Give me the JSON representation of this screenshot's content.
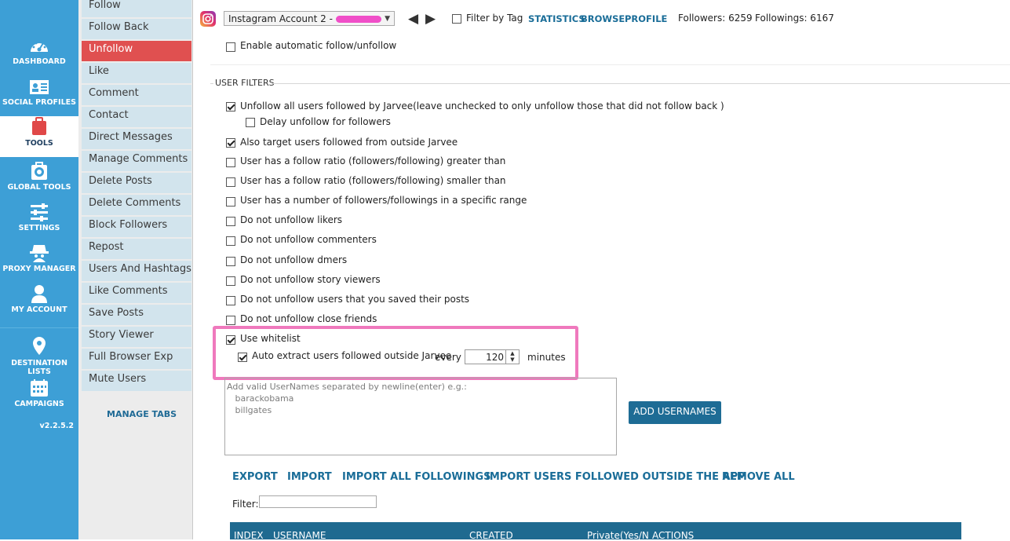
{
  "nav": {
    "items": [
      {
        "label": "DASHBOARD"
      },
      {
        "label": "SOCIAL PROFILES"
      },
      {
        "label": "TOOLS"
      },
      {
        "label": "GLOBAL TOOLS"
      },
      {
        "label": "SETTINGS"
      },
      {
        "label": "PROXY MANAGER"
      },
      {
        "label": "MY ACCOUNT"
      },
      {
        "label": "DESTINATION LISTS"
      },
      {
        "label": "CAMPAIGNS"
      }
    ],
    "active": "TOOLS",
    "version": "v2.2.5.2",
    "accent_color": "#3d9fd6"
  },
  "submenu": {
    "items": [
      "Follow",
      "Follow Back",
      "Unfollow",
      "Like",
      "Comment",
      "Contact",
      "Direct Messages",
      "Manage Comments",
      "Delete Posts",
      "Delete Comments",
      "Block Followers",
      "Repost",
      "Users And Hashtags",
      "Like Comments",
      "Save Posts",
      "Story Viewer",
      "Full Browser Exp",
      "Mute Users"
    ],
    "active": "Unfollow",
    "manage_tabs": "MANAGE TABS",
    "active_color": "#e05050"
  },
  "topbar": {
    "account": "Instagram Account 2 -",
    "filter_by_tag": "Filter by Tag",
    "links": [
      "STATISTICS",
      "BROWSE",
      "PROFILE"
    ],
    "followers": "Followers: 6259",
    "followings": "Followings: 6167"
  },
  "settings": {
    "enable_auto": {
      "label": "Enable automatic follow/unfollow",
      "checked": false
    },
    "section_title": "USER FILTERS",
    "filters": [
      {
        "label": "Unfollow all users followed by Jarvee(leave unchecked to only unfollow those that did not follow back )",
        "checked": true
      },
      {
        "label": "Delay unfollow for followers",
        "checked": false
      },
      {
        "label": "Also target users followed from outside Jarvee",
        "checked": true
      },
      {
        "label": "User has a follow ratio (followers/following) greater than",
        "checked": false
      },
      {
        "label": "User has a follow ratio (followers/following) smaller than",
        "checked": false
      },
      {
        "label": "User has a number of followers/followings in a specific range",
        "checked": false
      },
      {
        "label": "Do not unfollow likers",
        "checked": false
      },
      {
        "label": "Do not unfollow commenters",
        "checked": false
      },
      {
        "label": "Do not unfollow dmers",
        "checked": false
      },
      {
        "label": "Do not unfollow story viewers",
        "checked": false
      },
      {
        "label": "Do not unfollow users that you saved their posts",
        "checked": false
      },
      {
        "label": "Do not unfollow close friends",
        "checked": false
      }
    ],
    "whitelist": {
      "label": "Use whitelist",
      "checked": true
    },
    "auto_extract": {
      "label": "Auto extract users followed outside Jarvee",
      "checked": true,
      "every": "every",
      "value": "120",
      "unit": "minutes"
    },
    "highlight_color": "#ef79bd"
  },
  "whitelist_box": {
    "placeholder": "Add valid UserNames separated by newline(enter) e.g.:\n   barackobama\n   billgates",
    "add_button": "ADD USERNAMES"
  },
  "actions": [
    "EXPORT",
    "IMPORT",
    "IMPORT ALL FOLLOWINGS",
    "IMPORT USERS FOLLOWED OUTSIDE THE APP",
    "REMOVE ALL"
  ],
  "filter_label": "Filter:",
  "table": {
    "headers": [
      "INDEX",
      "USERNAME",
      "CREATED",
      "Private(Yes/N",
      "ACTIONS"
    ]
  }
}
